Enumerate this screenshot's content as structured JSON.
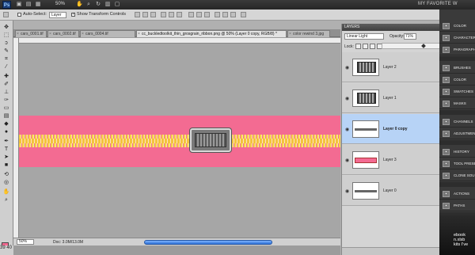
{
  "app": {
    "logo": "Ps",
    "zoom": "50%",
    "workspace": "MY FAVORITE W"
  },
  "options": {
    "auto_select_label": "Auto-Select:",
    "auto_select_value": "Layer",
    "show_transform_label": "Show Transform Controls",
    "show_transform_checked": true
  },
  "tabs": [
    {
      "label": "cars_0001.tif"
    },
    {
      "label": "cars_0002.tif"
    },
    {
      "label": "cars_0004.tif"
    },
    {
      "label": "cc_buckledtoolkit_thin_grosgrain_ribbon.png @ 50% (Layer 0 copy, RGB/8) *"
    },
    {
      "label": "color rewind 3.jpg"
    }
  ],
  "window_title": "cc_buckledtoolkit_thin_grosgrain_ribbon.png @ 50% (Layer 0 copy, RGB/8) *",
  "status": {
    "zoom": "50%",
    "doc": "Doc: 3.0M/13.0M"
  },
  "bottom_left": "39 40",
  "layers_panel": {
    "title": "LAYERS",
    "blend_mode": "Linear Light",
    "opacity_label": "Opacity:",
    "opacity": "71%",
    "lock_label": "Lock:",
    "opacity_slider_fraction": 0.71,
    "layers": [
      {
        "name": "Layer 2",
        "thumb": "buckle",
        "selected": false
      },
      {
        "name": "Layer 1",
        "thumb": "buckle",
        "selected": false
      },
      {
        "name": "Layer 0 copy",
        "thumb": "bar",
        "selected": true
      },
      {
        "name": "Layer 3",
        "thumb": "ribbon",
        "selected": false
      },
      {
        "name": "Layer 0",
        "thumb": "bar",
        "selected": false
      }
    ]
  },
  "panels": [
    {
      "label": "COLOR",
      "icon": "color-icon"
    },
    {
      "label": "CHARACTER",
      "icon": "character-icon"
    },
    {
      "label": "PARAGRAPH",
      "icon": "paragraph-icon"
    },
    {
      "label": "BRUSHES",
      "icon": "brushes-icon"
    },
    {
      "label": "COLOR",
      "icon": "color-swatch-icon"
    },
    {
      "label": "SWATCHES",
      "icon": "swatches-icon"
    },
    {
      "label": "MASKS",
      "icon": "masks-icon"
    },
    {
      "label": "CHANNELS",
      "icon": "channels-icon"
    },
    {
      "label": "ADJUSTMEN",
      "icon": "adjustments-icon"
    },
    {
      "label": "HISTORY",
      "icon": "history-icon"
    },
    {
      "label": "TOOL PRESE",
      "icon": "tool-presets-icon"
    },
    {
      "label": "CLONE SOU",
      "icon": "clone-source-icon"
    },
    {
      "label": "ACTIONS",
      "icon": "actions-icon"
    },
    {
      "label": "PATHS",
      "icon": "paths-icon"
    }
  ],
  "desktop_text": "ebook\nn.xlsb\nkits I've",
  "colors": {
    "foreground": "#f56a92",
    "background": "#ffffff",
    "ribbon": "#f36b92",
    "selected_layer": "#b7d3f6"
  }
}
